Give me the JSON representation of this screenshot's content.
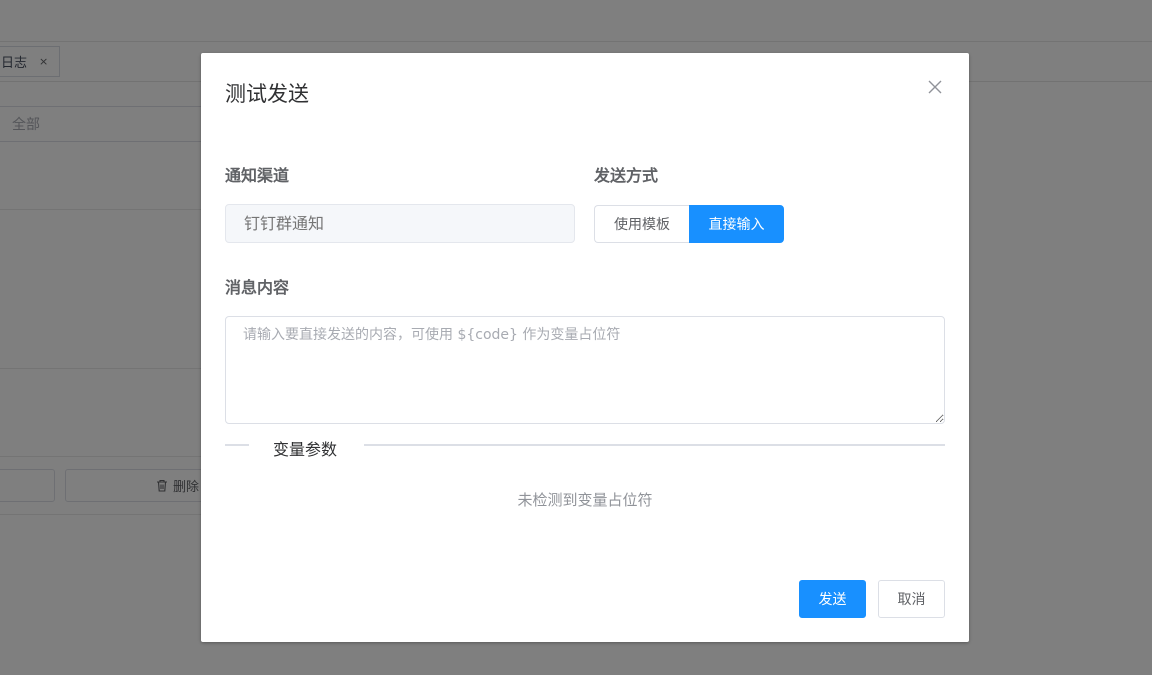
{
  "background": {
    "tab_label": "日志",
    "tab_close": "×",
    "filter_select_value": "全部",
    "delete_button_label": "删除"
  },
  "dialog": {
    "title": "测试发送",
    "close_icon": "close-icon",
    "channel_label": "通知渠道",
    "channel_placeholder": "钉钉群通知",
    "send_mode_label": "发送方式",
    "send_mode_options": [
      "使用模板",
      "直接输入"
    ],
    "send_mode_selected": "直接输入",
    "content_label": "消息内容",
    "content_value": "",
    "content_placeholder": "请输入要直接发送的内容，可使用 ${code} 作为变量占位符",
    "variables_divider": "变量参数",
    "variables_empty": "未检测到变量占位符",
    "send_button": "发送",
    "cancel_button": "取消"
  },
  "colors": {
    "primary": "#1890ff",
    "overlay": "rgba(0,0,0,0.5)"
  }
}
